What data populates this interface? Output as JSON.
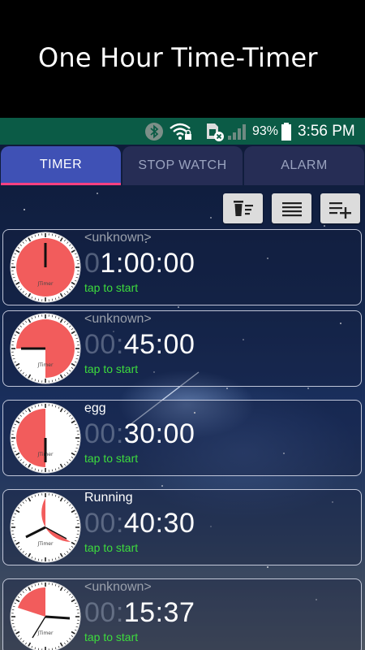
{
  "banner": {
    "title": "One Hour Time-Timer"
  },
  "status_bar": {
    "battery": "93%",
    "time": "3:56 PM"
  },
  "tabs": [
    {
      "label": "TIMER",
      "active": true
    },
    {
      "label": "STOP WATCH",
      "active": false
    },
    {
      "label": "ALARM",
      "active": false
    }
  ],
  "toolbar": {
    "icons": [
      "delete-sort-icon",
      "list-icon",
      "playlist-add-icon"
    ]
  },
  "clock_brand": "JTimer",
  "timers": [
    {
      "label": "<unknown>",
      "time_dim": "0",
      "time_bright": "1:00:00",
      "hint": "tap to start",
      "label_color": "#9aa0ab"
    },
    {
      "label": "<unknown>",
      "time_dim": "00:",
      "time_bright": "45:00",
      "hint": "tap to start",
      "label_color": "#9aa0ab"
    },
    {
      "label": "egg",
      "time_dim": "00:",
      "time_bright": "30:00",
      "hint": "tap to start",
      "label_color": "#ffffff"
    },
    {
      "label": "Running",
      "time_dim": "00:",
      "time_bright": "40:30",
      "hint": "tap to start",
      "label_color": "#ffffff"
    },
    {
      "label": "<unknown>",
      "time_dim": "00:",
      "time_bright": "15:37",
      "hint": "tap to start",
      "label_color": "#9aa0ab"
    }
  ],
  "colors": {
    "accent": "#ff4081",
    "tab_active": "#3f51b5",
    "hint": "#3ddc3d",
    "dial_fill": "#f25c5c",
    "status_bar": "#0b5b46"
  }
}
